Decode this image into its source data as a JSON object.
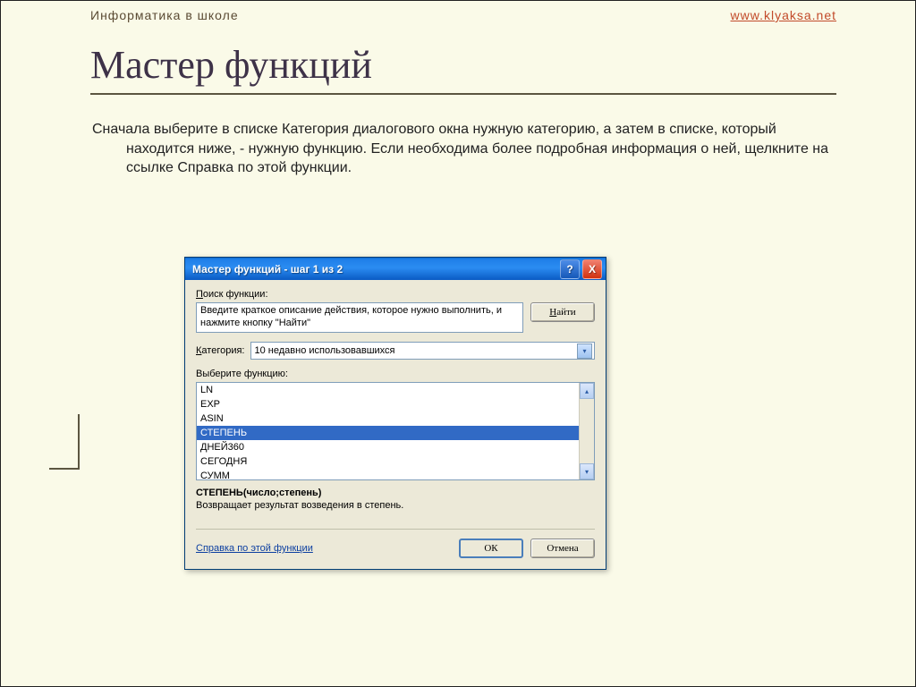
{
  "header": {
    "left": "Информатика в школе",
    "right": "www.klyaksa.net"
  },
  "title": "Мастер функций",
  "body": "Сначала выберите в списке Категория диалогового окна нужную категорию, а затем в списке, который находится ниже, - нужную функцию. Если необходима более подробная информация о ней, щелкните на ссылке Справка по этой функции.",
  "dialog": {
    "title": "Мастер функций - шаг 1 из 2",
    "help_btn": "?",
    "close_btn": "X",
    "search_label_prefix": "П",
    "search_label_rest": "оиск функции:",
    "search_text": "Введите краткое описание действия, которое нужно выполнить, и нажмите кнопку \"Найти\"",
    "find_btn_prefix": "Н",
    "find_btn_rest": "айти",
    "category_label_prefix": "К",
    "category_label_rest": "атегория:",
    "category_value": "10 недавно использовавшихся",
    "select_fn_label": "Выберите функцию:",
    "functions": [
      "LN",
      "EXP",
      "ASIN",
      "СТЕПЕНЬ",
      "ДНЕЙ360",
      "СЕГОДНЯ",
      "СУММ"
    ],
    "selected_index": 3,
    "signature": "СТЕПЕНЬ(число;степень)",
    "description": "Возвращает результат возведения в степень.",
    "help_link": "Справка по этой функции",
    "ok": "ОК",
    "cancel": "Отмена"
  }
}
